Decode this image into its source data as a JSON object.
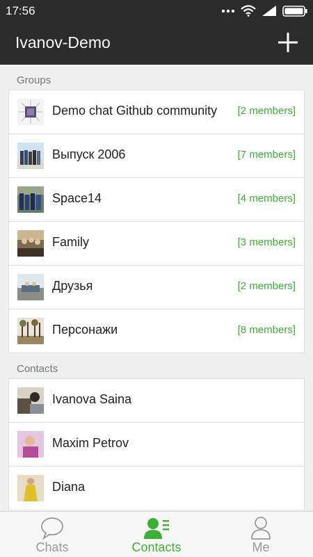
{
  "status": {
    "time": "17:56"
  },
  "header": {
    "title": "Ivanov-Demo"
  },
  "groups_label": "Groups",
  "groups": [
    {
      "name": "Demo chat Github community",
      "members": "[2 members]"
    },
    {
      "name": "Выпуск 2006",
      "members": "[7 members]"
    },
    {
      "name": "Space14",
      "members": "[4 members]"
    },
    {
      "name": "Family",
      "members": "[3 members]"
    },
    {
      "name": "Друзья",
      "members": "[2 members]"
    },
    {
      "name": "Персонажи",
      "members": "[8 members]"
    }
  ],
  "contacts_label": "Contacts",
  "contacts": [
    {
      "name": "Ivanova Saina"
    },
    {
      "name": "Maxim Petrov"
    },
    {
      "name": "Diana"
    }
  ],
  "tabs": [
    {
      "label": "Chats",
      "icon": "chat-bubble-icon"
    },
    {
      "label": "Contacts",
      "icon": "contacts-icon"
    },
    {
      "label": "Me",
      "icon": "person-icon"
    }
  ],
  "colors": {
    "accent": "#3cb034",
    "appbar": "#2b2b2b"
  }
}
